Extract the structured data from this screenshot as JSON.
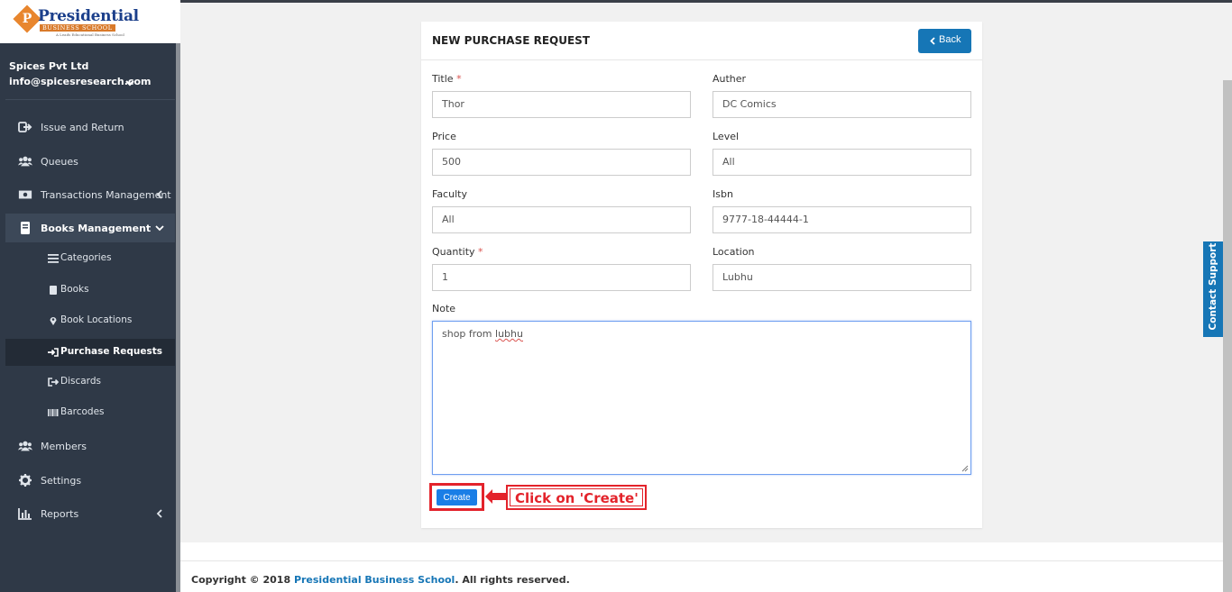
{
  "logo": {
    "initial": "P",
    "name": "Presidential",
    "sub": "BUSINESS SCHOOL",
    "tagline": "A Leads Educational Business School"
  },
  "account": {
    "company": "Spices Pvt Ltd",
    "email": "info@spicesresearch.com"
  },
  "sidebar": {
    "items": [
      {
        "label": "Issue and Return",
        "icon": "sign-out-icon"
      },
      {
        "label": "Queues",
        "icon": "users-icon"
      },
      {
        "label": "Transactions Management",
        "icon": "money-icon"
      },
      {
        "label": "Books Management",
        "icon": "book-icon"
      },
      {
        "label": "Members",
        "icon": "users-icon"
      },
      {
        "label": "Settings",
        "icon": "gear-icon"
      },
      {
        "label": "Reports",
        "icon": "bar-chart-icon"
      }
    ],
    "sub_items": [
      {
        "label": "Categories",
        "icon": "list-icon"
      },
      {
        "label": "Books",
        "icon": "book-icon"
      },
      {
        "label": "Book Locations",
        "icon": "map-marker-icon"
      },
      {
        "label": "Purchase Requests",
        "icon": "sign-in-icon"
      },
      {
        "label": "Discards",
        "icon": "sign-out-icon"
      },
      {
        "label": "Barcodes",
        "icon": "barcode-icon"
      }
    ]
  },
  "form": {
    "title": "NEW PURCHASE REQUEST",
    "back_label": "Back",
    "required_mark": "*",
    "fields": {
      "title": {
        "label": "Title",
        "value": "Thor"
      },
      "auther": {
        "label": "Auther",
        "value": "DC Comics"
      },
      "price": {
        "label": "Price",
        "value": "500"
      },
      "level": {
        "label": "Level",
        "value": "All"
      },
      "faculty": {
        "label": "Faculty",
        "value": "All"
      },
      "isbn": {
        "label": "Isbn",
        "value": "9777-18-44444-1"
      },
      "quantity": {
        "label": "Quantity",
        "value": "1"
      },
      "location": {
        "label": "Location",
        "value": "Lubhu"
      },
      "note": {
        "label": "Note",
        "value_prefix": "shop from ",
        "value_flagged": "lubhu"
      }
    },
    "create_label": "Create"
  },
  "annotation": {
    "callout": "Click on 'Create'",
    "color": "#e3232b"
  },
  "contact_support": "Contact Support",
  "footer": {
    "prefix": "Copyright © 2018 ",
    "link": "Presidential Business School",
    "suffix": ". All rights reserved."
  },
  "colors": {
    "sidebar_bg": "#2f3947",
    "accent": "#1676b6",
    "create_button": "#1a7ee6"
  }
}
